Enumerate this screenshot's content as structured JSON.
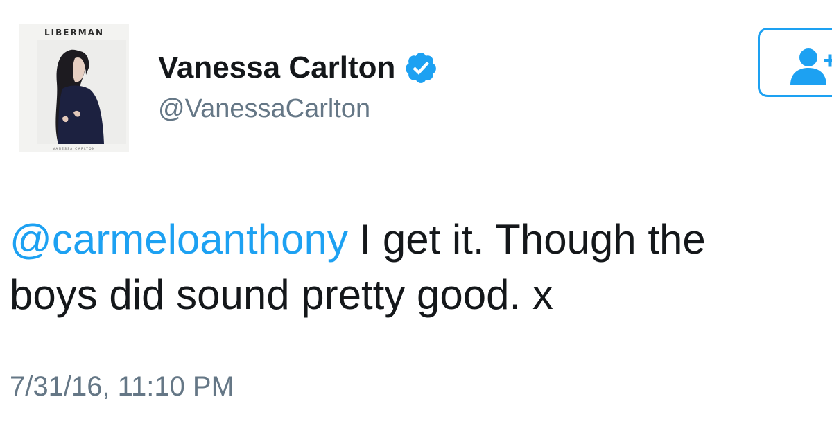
{
  "profile": {
    "avatar": {
      "album_title": "LIBERMAN",
      "album_caption": "VANESSA CARLTON"
    },
    "display_name": "Vanessa Carlton",
    "handle": "@VanessaCarlton",
    "verified": true,
    "verified_icon": "verified-badge-icon",
    "follow_icon": "add-user-icon"
  },
  "tweet": {
    "mention": "@carmeloanthony",
    "line1_text": " I get it. Though the",
    "line2_text": "boys did sound pretty good. x",
    "timestamp": "7/31/16, 11:10 PM"
  },
  "colors": {
    "link": "#1da1f2",
    "text": "#14171a",
    "secondary": "#657786"
  }
}
